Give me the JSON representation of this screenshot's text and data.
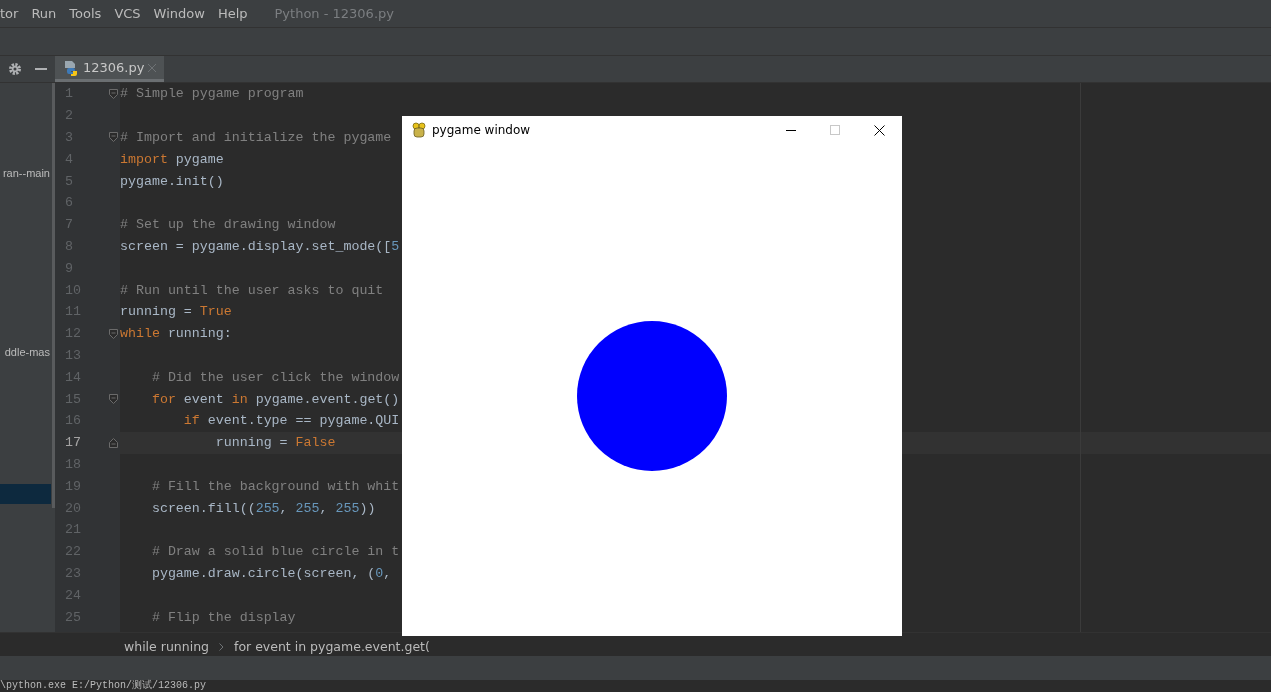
{
  "menu": [
    "tor",
    "Run",
    "Tools",
    "VCS",
    "Window",
    "Help"
  ],
  "window": {
    "title": "Python - 12306.py"
  },
  "tabs": [
    {
      "label": "12306.py",
      "selected": true
    }
  ],
  "sidebar": {
    "items": [
      {
        "label": "ran--main"
      },
      {
        "label": "ddle-mas"
      }
    ]
  },
  "editor": {
    "lines": [
      {
        "number": "1",
        "current": false,
        "fold_start": true,
        "tokens": [
          {
            "kind": "comment",
            "text": "# Simple pygame program"
          }
        ]
      },
      {
        "number": "2",
        "current": false
      },
      {
        "number": "3",
        "current": false,
        "fold_start": true,
        "tokens": [
          {
            "kind": "comment",
            "text": "# Import and initialize the pygame"
          }
        ]
      },
      {
        "number": "4",
        "current": false,
        "tokens": [
          {
            "kind": "keyword",
            "text": "import"
          },
          {
            "kind": "plain",
            "text": " pygame"
          }
        ]
      },
      {
        "number": "5",
        "current": false,
        "tokens": [
          {
            "kind": "plain",
            "text": "pygame.init()"
          }
        ]
      },
      {
        "number": "6",
        "current": false
      },
      {
        "number": "7",
        "current": false,
        "tokens": [
          {
            "kind": "comment",
            "text": "# Set up the drawing window"
          }
        ]
      },
      {
        "number": "8",
        "current": false,
        "tokens": [
          {
            "kind": "plain",
            "text": "screen = pygame.display.set_mode(["
          },
          {
            "kind": "number",
            "text": "5"
          }
        ]
      },
      {
        "number": "9",
        "current": false
      },
      {
        "number": "10",
        "current": false,
        "tokens": [
          {
            "kind": "comment",
            "text": "# Run until the user asks to quit"
          }
        ]
      },
      {
        "number": "11",
        "current": false,
        "tokens": [
          {
            "kind": "plain",
            "text": "running = "
          },
          {
            "kind": "keyword",
            "text": "True"
          }
        ]
      },
      {
        "number": "12",
        "current": false,
        "fold_start": true,
        "tokens": [
          {
            "kind": "keyword",
            "text": "while"
          },
          {
            "kind": "plain",
            "text": " running:"
          }
        ]
      },
      {
        "number": "13",
        "current": false
      },
      {
        "number": "14",
        "current": false,
        "tokens": [
          {
            "kind": "comment",
            "text": "    # Did the user click the window"
          }
        ]
      },
      {
        "number": "15",
        "current": false,
        "fold_start": true,
        "tokens": [
          {
            "kind": "keyword",
            "text": "    for"
          },
          {
            "kind": "plain",
            "text": " event "
          },
          {
            "kind": "keyword",
            "text": "in"
          },
          {
            "kind": "plain",
            "text": " pygame.event.get()"
          }
        ]
      },
      {
        "number": "16",
        "current": false,
        "tokens": [
          {
            "kind": "keyword",
            "text": "        if"
          },
          {
            "kind": "plain",
            "text": " event.type == pygame.QUI"
          }
        ]
      },
      {
        "number": "17",
        "current": true,
        "fold_end": true,
        "tokens": [
          {
            "kind": "plain",
            "text": "            running = "
          },
          {
            "kind": "keyword",
            "text": "False"
          }
        ]
      },
      {
        "number": "18",
        "current": false
      },
      {
        "number": "19",
        "current": false,
        "tokens": [
          {
            "kind": "comment",
            "text": "    # Fill the background with whit"
          }
        ]
      },
      {
        "number": "20",
        "current": false,
        "tokens": [
          {
            "kind": "plain",
            "text": "    screen.fill(("
          },
          {
            "kind": "number",
            "text": "255"
          },
          {
            "kind": "plain",
            "text": ", "
          },
          {
            "kind": "number",
            "text": "255"
          },
          {
            "kind": "plain",
            "text": ", "
          },
          {
            "kind": "number",
            "text": "255"
          },
          {
            "kind": "plain",
            "text": "))"
          }
        ]
      },
      {
        "number": "21",
        "current": false
      },
      {
        "number": "22",
        "current": false,
        "tokens": [
          {
            "kind": "comment",
            "text": "    # Draw a solid blue circle in t"
          }
        ]
      },
      {
        "number": "23",
        "current": false,
        "tokens": [
          {
            "kind": "plain",
            "text": "    pygame.draw.circle(screen, ("
          },
          {
            "kind": "number",
            "text": "0"
          },
          {
            "kind": "plain",
            "text": ", "
          }
        ]
      },
      {
        "number": "24",
        "current": false
      },
      {
        "number": "25",
        "current": false,
        "tokens": [
          {
            "kind": "comment",
            "text": "    # Flip the display"
          }
        ]
      }
    ]
  },
  "breadcrumb": [
    "while running",
    "for event in pygame.event.get("
  ],
  "console": {
    "line": "\\python.exe E:/Python/测试/12306.py"
  },
  "pygame_window": {
    "title": "pygame window"
  }
}
